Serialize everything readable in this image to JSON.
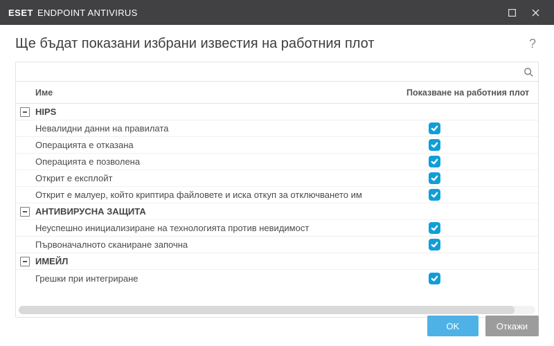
{
  "titlebar": {
    "brand": "ESET",
    "product": "ENDPOINT ANTIVIRUS"
  },
  "header": {
    "title": "Ще бъдат показани избрани известия на работния плот",
    "help": "?"
  },
  "search": {
    "placeholder": ""
  },
  "columns": {
    "name": "Име",
    "show": "Показване на работния плот"
  },
  "groups": [
    {
      "name": "HIPS",
      "expanded": true,
      "items": [
        {
          "label": "Невалидни данни на правилата",
          "checked": true
        },
        {
          "label": "Операцията е отказана",
          "checked": true
        },
        {
          "label": "Операцията е позволена",
          "checked": true
        },
        {
          "label": "Открит е експлойт",
          "checked": true
        },
        {
          "label": "Открит е малуер, който криптира файловете и иска откуп за отключването им",
          "checked": true
        }
      ]
    },
    {
      "name": "АНТИВИРУСНА ЗАЩИТА",
      "expanded": true,
      "items": [
        {
          "label": "Неуспешно инициализиране на технологията против невидимост",
          "checked": true
        },
        {
          "label": "Първоначалното сканиране започна",
          "checked": true
        }
      ]
    },
    {
      "name": "ИМЕЙЛ",
      "expanded": true,
      "items": [
        {
          "label": "Грешки при интегриране",
          "checked": true
        }
      ]
    }
  ],
  "footer": {
    "ok": "OK",
    "cancel": "Откажи"
  }
}
